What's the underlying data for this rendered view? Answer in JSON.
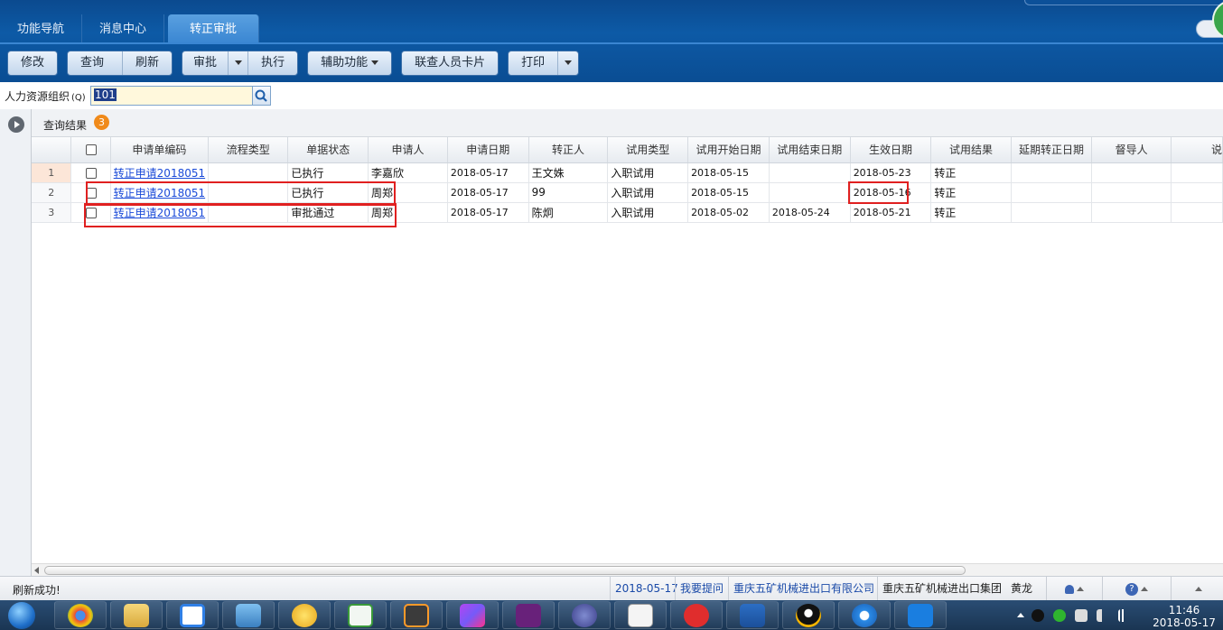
{
  "header": {
    "tabs": [
      {
        "label": "功能导航"
      },
      {
        "label": "消息中心"
      },
      {
        "label": "转正审批"
      }
    ]
  },
  "toolbar": {
    "edit": "修改",
    "query": "查询",
    "refresh": "刷新",
    "approve": "审批",
    "execute": "执行",
    "aux": "辅助功能",
    "card": "联查人员卡片",
    "print": "打印"
  },
  "filter": {
    "label": "人力资源组织",
    "hotkey": "(Q)",
    "value": "101"
  },
  "results": {
    "title": "查询结果",
    "count": "3"
  },
  "table": {
    "headers": [
      "申请单编码",
      "流程类型",
      "单据状态",
      "申请人",
      "申请日期",
      "转正人",
      "试用类型",
      "试用开始日期",
      "试用结束日期",
      "生效日期",
      "试用结果",
      "延期转正日期",
      "督导人",
      "说"
    ],
    "rows": [
      {
        "n": "1",
        "code": "转正申请2018051",
        "flow": "",
        "status": "已执行",
        "applicant": "李嘉欣",
        "apply_date": "2018-05-17",
        "person": "王文姝",
        "type": "入职试用",
        "start": "2018-05-15",
        "end": "",
        "effective": "2018-05-23",
        "result": "转正",
        "delay": "",
        "supervisor": ""
      },
      {
        "n": "2",
        "code": "转正申请2018051",
        "flow": "",
        "status": "已执行",
        "applicant": "周郑",
        "apply_date": "2018-05-17",
        "person": "99",
        "type": "入职试用",
        "start": "2018-05-15",
        "end": "",
        "effective": "2018-05-16",
        "result": "转正",
        "delay": "",
        "supervisor": ""
      },
      {
        "n": "3",
        "code": "转正申请2018051",
        "flow": "",
        "status": "审批通过",
        "applicant": "周郑",
        "apply_date": "2018-05-17",
        "person": "陈炯",
        "type": "入职试用",
        "start": "2018-05-02",
        "end": "2018-05-24",
        "effective": "2018-05-21",
        "result": "转正",
        "delay": "",
        "supervisor": ""
      }
    ]
  },
  "status": {
    "message": "刷新成功!",
    "date": "2018-05-17",
    "feedback": "我要提问",
    "company": "重庆五矿机械进出口有限公司",
    "group": "重庆五矿机械进出口集团",
    "user": "黄龙"
  },
  "clock": {
    "time": "11:46",
    "date": "2018-05-17"
  },
  "colors": {
    "header_bg": "#0d5aa6",
    "highlight_box": "#e02020",
    "link": "#1a4ad8",
    "badge": "#f08a1a"
  }
}
